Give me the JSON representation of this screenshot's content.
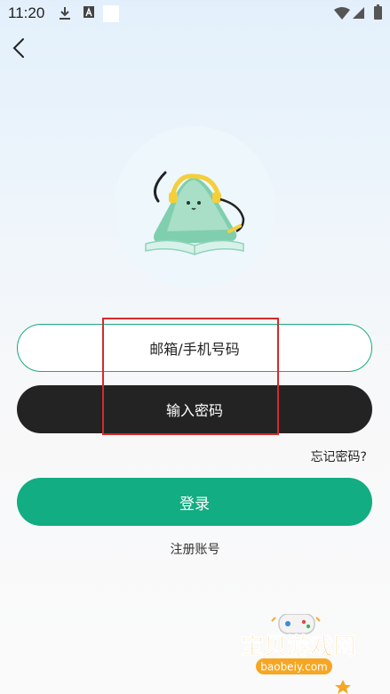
{
  "status_bar": {
    "time": "11:20",
    "icons": [
      "download-icon",
      "a-icon",
      "blank-notification-icon",
      "wifi-icon",
      "signal-icon",
      "battery-icon"
    ]
  },
  "nav": {
    "back_icon": "chevron-left-icon"
  },
  "logo": {
    "icon": "mascot-logo"
  },
  "form": {
    "email_placeholder": "邮箱/手机号码",
    "password_placeholder": "输入密码",
    "forgot_label": "忘记密码?",
    "login_label": "登录",
    "register_label": "注册账号"
  },
  "watermark": {
    "title": "宝贝游戏网",
    "url": "baobeiy.com"
  },
  "colors": {
    "accent": "#12ad82",
    "dark_field": "#232323",
    "highlight_box": "#d42a2a"
  }
}
